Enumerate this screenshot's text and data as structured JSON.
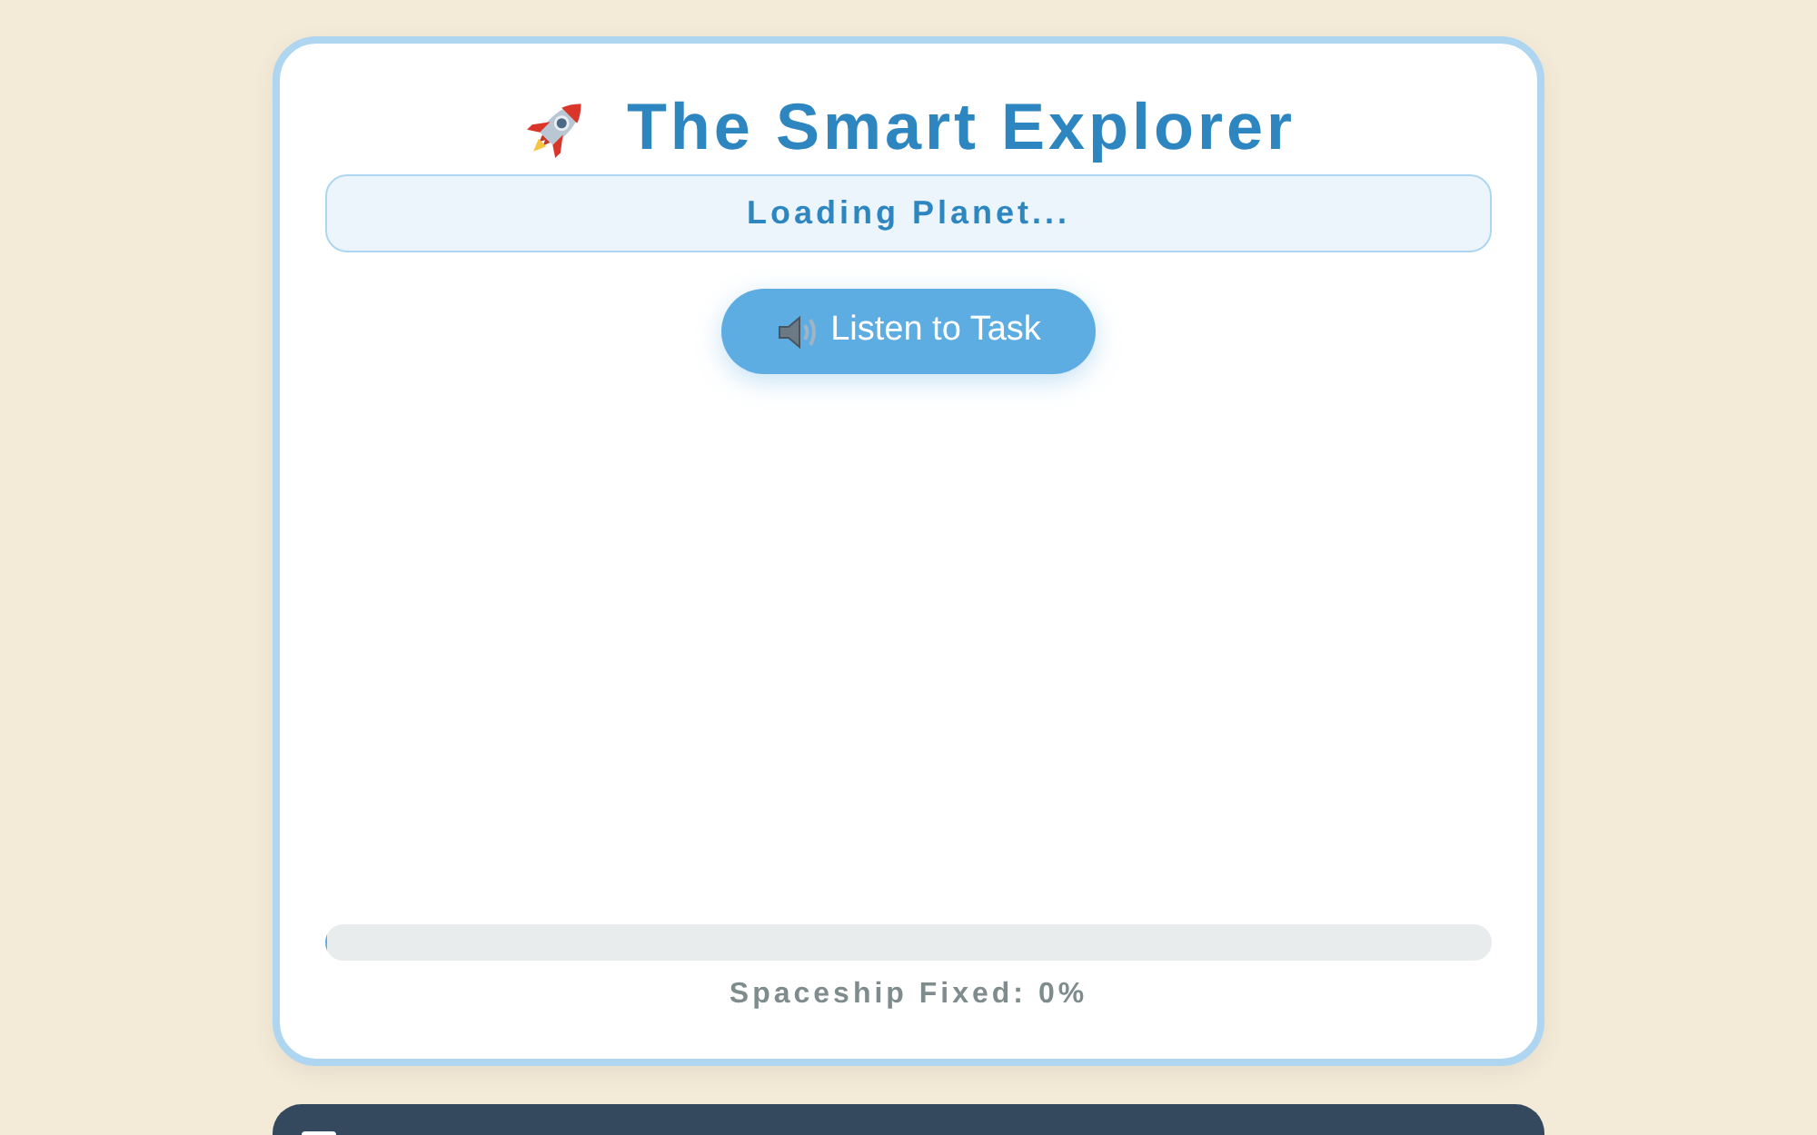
{
  "header": {
    "title": "The Smart Explorer"
  },
  "status": {
    "text": "Loading Planet..."
  },
  "listen_button": {
    "label": "Listen to Task"
  },
  "progress": {
    "level": 0,
    "label": "Spaceship Fixed: 0%"
  }
}
